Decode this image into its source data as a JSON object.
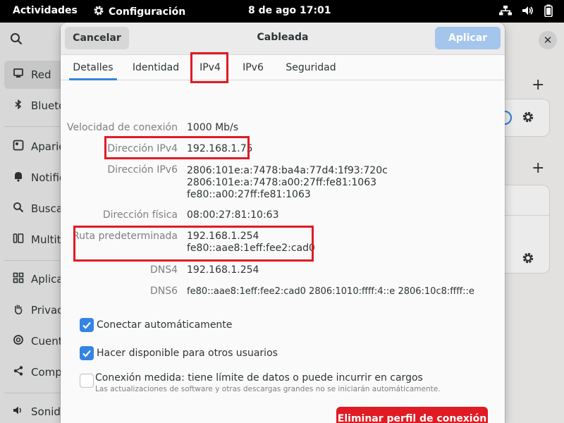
{
  "topbar": {
    "activities": "Actividades",
    "app_name": "Configuración",
    "clock": "8 de ago  17:01"
  },
  "sidebar": {
    "items": [
      {
        "label": "Red",
        "icon": "computer-icon"
      },
      {
        "label": "Bluetooth",
        "icon": "bluetooth-icon"
      },
      {
        "label": "Apariencia",
        "icon": "appearance-icon"
      },
      {
        "label": "Notificaciones",
        "icon": "bell-icon"
      },
      {
        "label": "Buscar",
        "icon": "search-icon"
      },
      {
        "label": "Multitarea",
        "icon": "multitask-icon"
      },
      {
        "label": "Aplicaciones",
        "icon": "apps-icon"
      },
      {
        "label": "Privacidad",
        "icon": "hand-icon"
      },
      {
        "label": "Cuentas en línea",
        "icon": "accounts-icon"
      },
      {
        "label": "Compartir",
        "icon": "share-icon"
      },
      {
        "label": "Sonido",
        "icon": "sound-icon"
      }
    ]
  },
  "dialog": {
    "cancel_label": "Cancelar",
    "title": "Cableada",
    "apply_label": "Aplicar",
    "tabs": [
      {
        "label": "Detalles"
      },
      {
        "label": "Identidad"
      },
      {
        "label": "IPv4"
      },
      {
        "label": "IPv6"
      },
      {
        "label": "Seguridad"
      }
    ],
    "details": {
      "speed_label": "Velocidad de conexión",
      "speed_value": "1000 Mb/s",
      "ipv4_label": "Dirección IPv4",
      "ipv4_value": "192.168.1.75",
      "ipv6_label": "Dirección IPv6",
      "ipv6_values": [
        "2806:101e:a:7478:ba4a:77d4:1f93:720c",
        "2806:101e:a:7478:a00:27ff:fe81:1063",
        "fe80::a00:27ff:fe81:1063"
      ],
      "mac_label": "Dirección física",
      "mac_value": "08:00:27:81:10:63",
      "route_label": "Ruta predeterminada",
      "route_values": [
        "192.168.1.254",
        "fe80::aae8:1eff:fee2:cad0"
      ],
      "dns4_label": "DNS4",
      "dns4_value": "192.168.1.254",
      "dns6_label": "DNS6",
      "dns6_value": "fe80::aae8:1eff:fee2:cad0 2806:1010:ffff:4::e 2806:10c8:ffff::e"
    },
    "options": {
      "auto_connect_label": "Conectar automáticamente",
      "auto_connect_checked": true,
      "share_label": "Hacer disponible para otros usuarios",
      "share_checked": true,
      "metered_label": "Conexión medida: tiene límite de datos o puede incurrir en cargos",
      "metered_sub": "Las actualizaciones de software y otras descargas grandes no se iniciarán automáticamente.",
      "metered_checked": false
    },
    "delete_label": "Eliminar perfil de conexión"
  },
  "colors": {
    "accent": "#3584e4",
    "destructive": "#e01b24",
    "highlight": "#e01b24"
  }
}
